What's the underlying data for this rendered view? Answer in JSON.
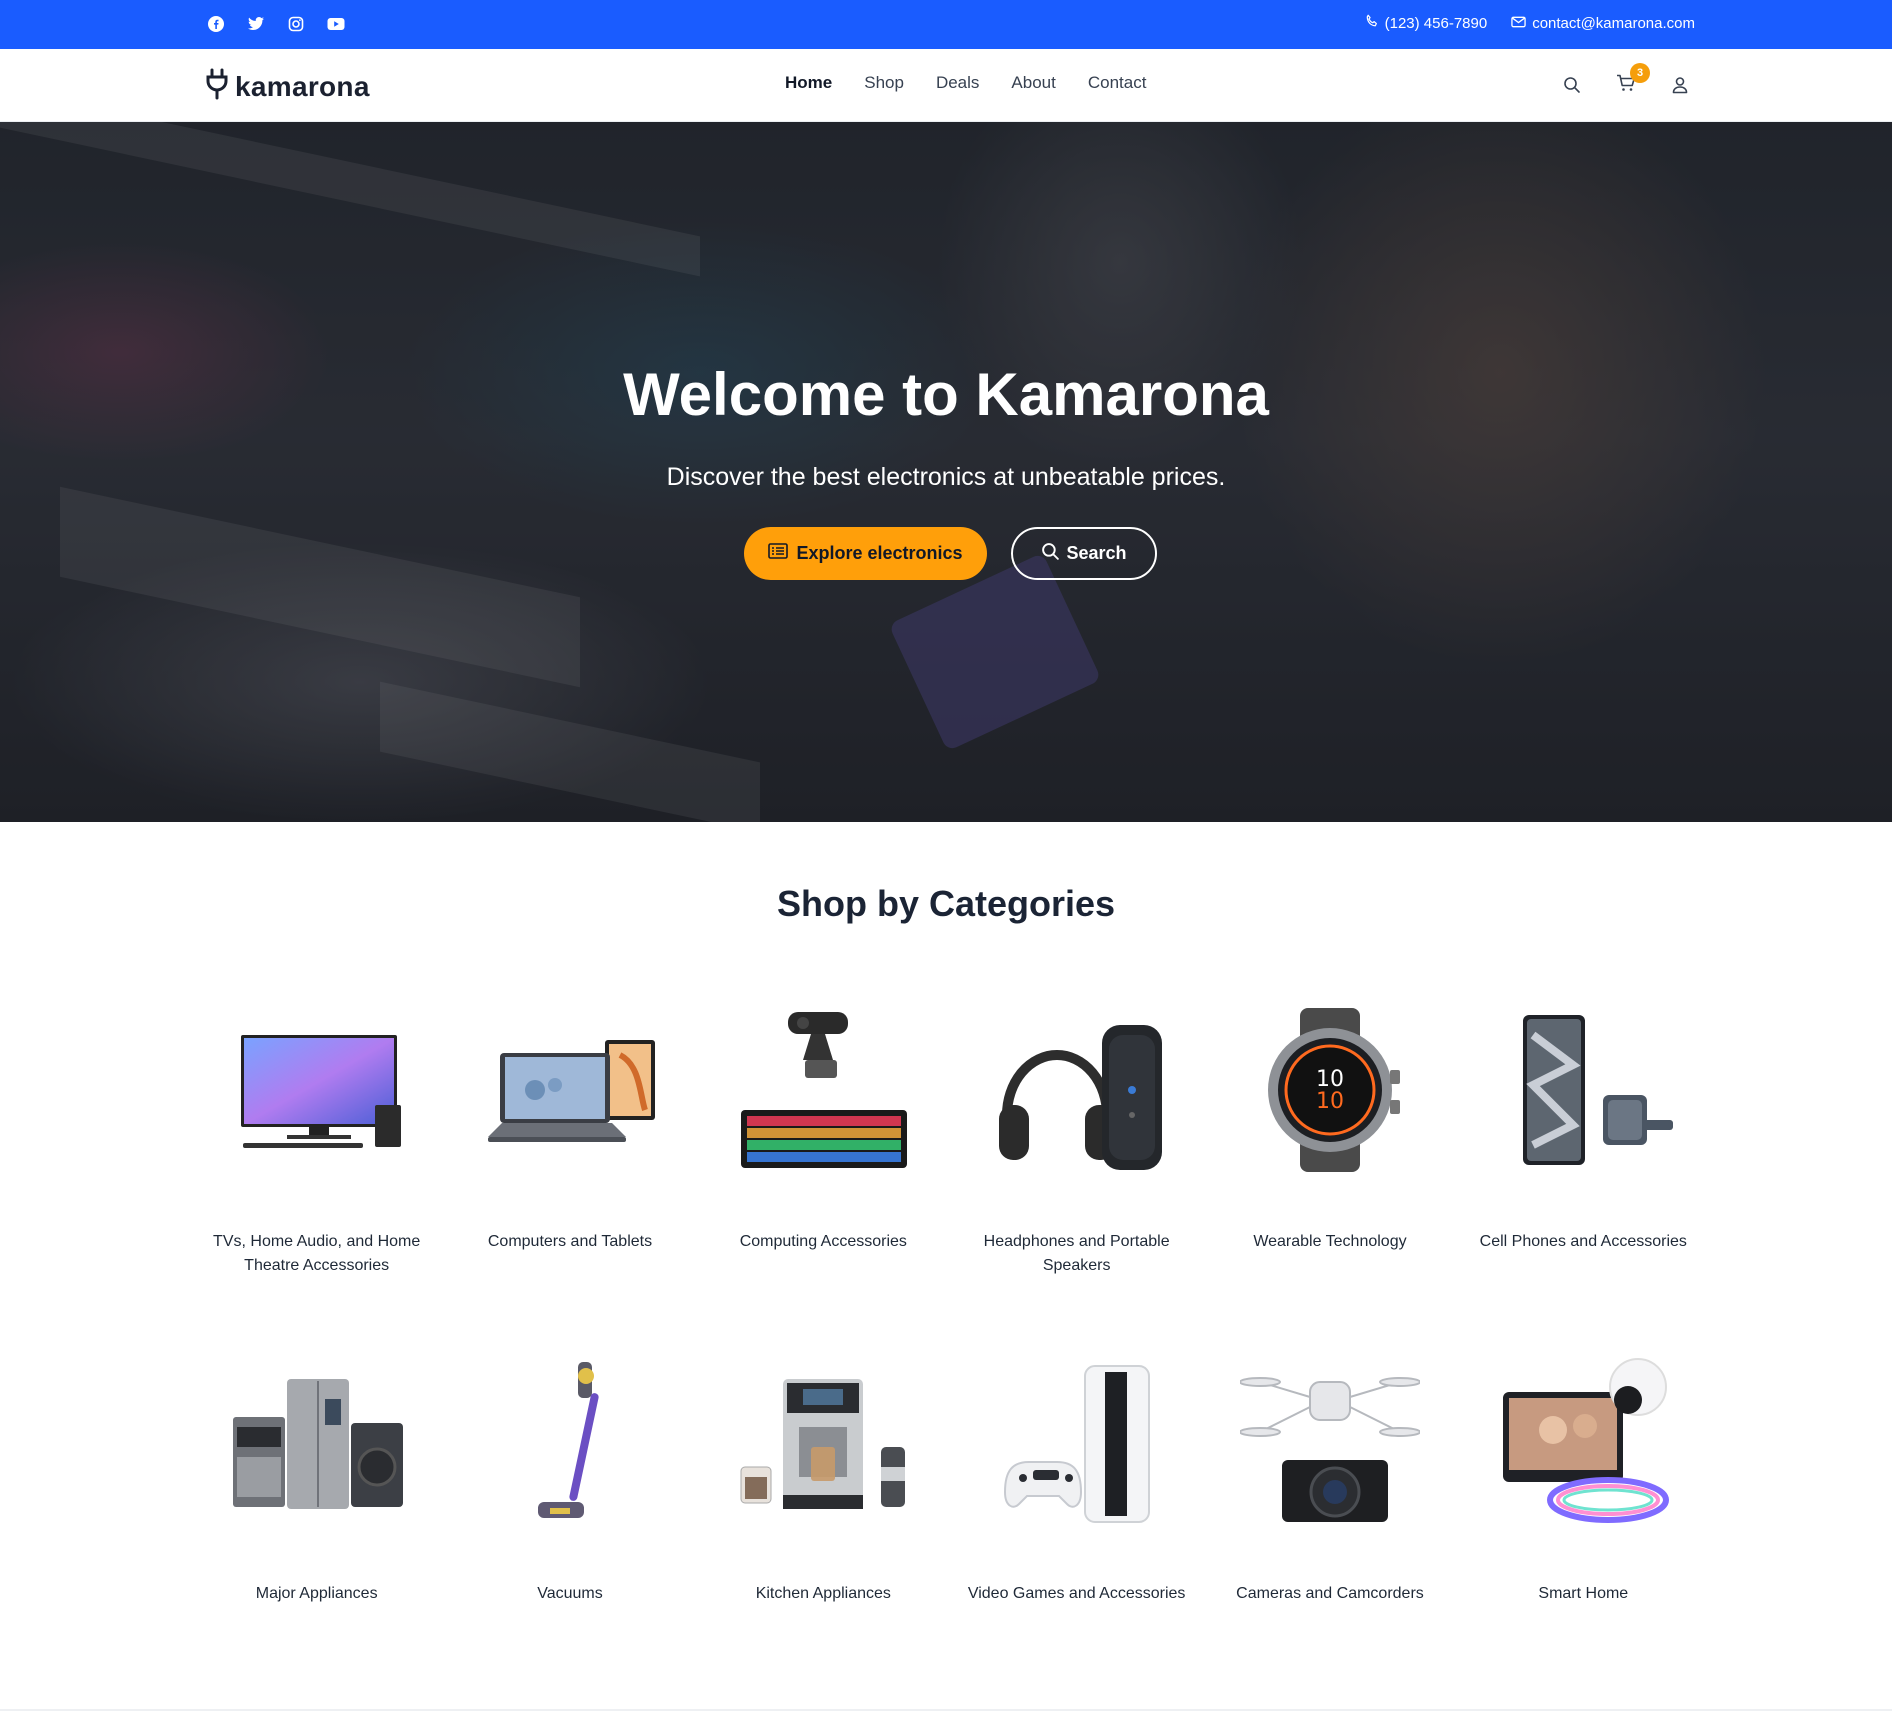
{
  "topbar": {
    "social_icons": [
      "facebook-icon",
      "twitter-icon",
      "instagram-icon",
      "youtube-icon"
    ],
    "phone": "(123) 456-7890",
    "email": "contact@kamarona.com",
    "background": "#1a5cff"
  },
  "header": {
    "logo_text": "kamarona",
    "nav": [
      {
        "label": "Home",
        "active": true
      },
      {
        "label": "Shop",
        "active": false
      },
      {
        "label": "Deals",
        "active": false
      },
      {
        "label": "About",
        "active": false
      },
      {
        "label": "Contact",
        "active": false
      }
    ],
    "cart_count": "3",
    "icons": [
      "search-icon",
      "cart-icon",
      "user-icon"
    ]
  },
  "hero": {
    "title": "Welcome to Kamarona",
    "subtitle": "Discover the best electronics at unbeatable prices.",
    "explore_label": "Explore electronics",
    "search_label": "Search",
    "accent": "#ff9f0a"
  },
  "categories": {
    "title": "Shop by Categories",
    "items": [
      {
        "label": "TVs, Home Audio, and Home Theatre Accessories",
        "icon": "tv-icon"
      },
      {
        "label": "Computers and Tablets",
        "icon": "laptop-icon"
      },
      {
        "label": "Computing Accessories",
        "icon": "keyboard-icon"
      },
      {
        "label": "Headphones and Portable Speakers",
        "icon": "headphones-icon"
      },
      {
        "label": "Wearable Technology",
        "icon": "smartwatch-icon"
      },
      {
        "label": "Cell Phones and Accessories",
        "icon": "phone-icon"
      },
      {
        "label": "Major Appliances",
        "icon": "fridge-icon"
      },
      {
        "label": "Vacuums",
        "icon": "vacuum-icon"
      },
      {
        "label": "Kitchen Appliances",
        "icon": "coffee-machine-icon"
      },
      {
        "label": "Video Games and Accessories",
        "icon": "console-icon"
      },
      {
        "label": "Cameras and Camcorders",
        "icon": "camera-icon"
      },
      {
        "label": "Smart Home",
        "icon": "smart-display-icon"
      }
    ]
  }
}
